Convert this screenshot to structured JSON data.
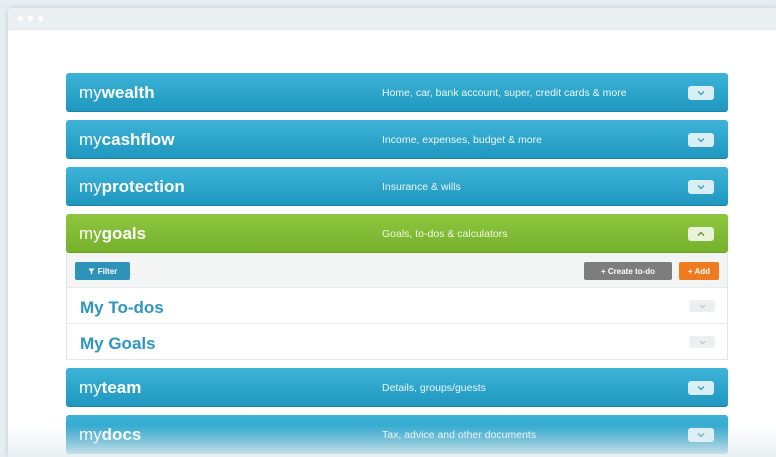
{
  "panels": {
    "wealth": {
      "prefix": "my",
      "name": "wealth",
      "desc": "Home, car, bank account, super, credit cards & more"
    },
    "cashflow": {
      "prefix": "my",
      "name": "cashflow",
      "desc": "Income, expenses, budget & more"
    },
    "protection": {
      "prefix": "my",
      "name": "protection",
      "desc": "Insurance & wills"
    },
    "goals": {
      "prefix": "my",
      "name": "goals",
      "desc": "Goals, to-dos & calculators"
    },
    "team": {
      "prefix": "my",
      "name": "team",
      "desc": "Details, groups/guests"
    },
    "docs": {
      "prefix": "my",
      "name": "docs",
      "desc": "Tax, advice and other documents"
    }
  },
  "goals_toolbar": {
    "filter_label": "Filter",
    "create_label": "+ Create to-do",
    "add_label": "+ Add"
  },
  "goals_rows": {
    "todos": "My To-dos",
    "goals": "My Goals"
  },
  "colors": {
    "panel_blue": "#2aa5cd",
    "panel_green": "#84bd36",
    "add_orange": "#f07a1e",
    "create_gray": "#7d7d7d",
    "link_blue": "#2e96c0"
  }
}
